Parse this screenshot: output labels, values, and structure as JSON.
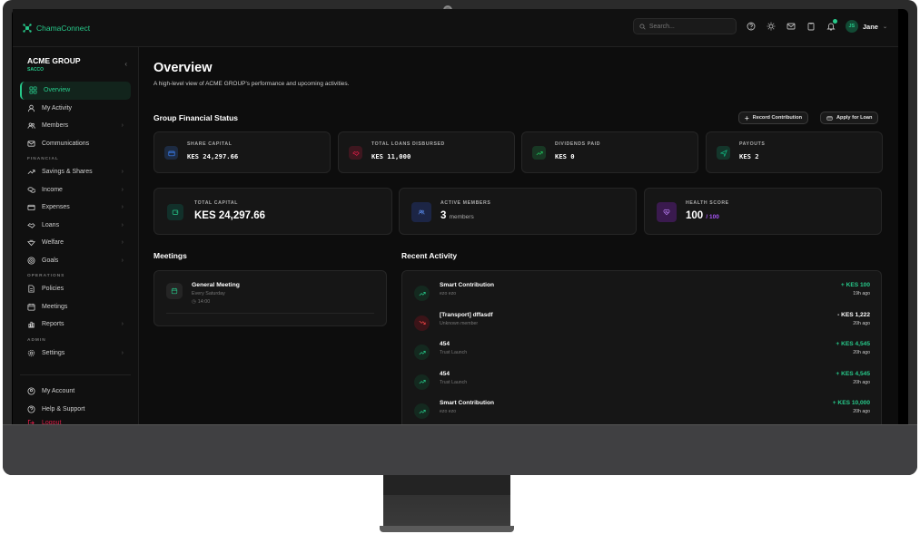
{
  "app": {
    "name": "ChamaConnect"
  },
  "topbar": {
    "search_placeholder": "Search...",
    "user_initials": "JS",
    "user_name": "Jane"
  },
  "sidebar": {
    "org_name": "ACME GROUP",
    "org_type": "SACCO",
    "items_main": [
      {
        "label": "Overview",
        "icon": "grid-icon",
        "active": true
      },
      {
        "label": "My Activity",
        "icon": "user-icon"
      },
      {
        "label": "Members",
        "icon": "users-icon",
        "chevron": true
      },
      {
        "label": "Communications",
        "icon": "mail-icon"
      }
    ],
    "section_financial": "FINANCIAL",
    "items_financial": [
      {
        "label": "Savings & Shares",
        "icon": "trending-up-icon",
        "chevron": true
      },
      {
        "label": "Income",
        "icon": "coins-icon",
        "chevron": true
      },
      {
        "label": "Expenses",
        "icon": "wallet-icon",
        "chevron": true
      },
      {
        "label": "Loans",
        "icon": "handshake-icon",
        "chevron": true
      },
      {
        "label": "Welfare",
        "icon": "heart-hand-icon",
        "chevron": true
      },
      {
        "label": "Goals",
        "icon": "target-icon",
        "chevron": true
      }
    ],
    "section_operations": "OPERATIONS",
    "items_operations": [
      {
        "label": "Policies",
        "icon": "document-icon"
      },
      {
        "label": "Meetings",
        "icon": "calendar-icon"
      },
      {
        "label": "Reports",
        "icon": "bar-chart-icon",
        "chevron": true
      }
    ],
    "section_admin": "ADMIN",
    "items_admin": [
      {
        "label": "Settings",
        "icon": "gear-icon",
        "chevron": true
      }
    ],
    "items_footer": [
      {
        "label": "My Account",
        "icon": "account-icon"
      },
      {
        "label": "Help & Support",
        "icon": "help-icon"
      },
      {
        "label": "Logout",
        "icon": "logout-icon"
      }
    ]
  },
  "overview": {
    "title": "Overview",
    "subtitle": "A high-level view of ACME GROUP's performance and upcoming activities.",
    "financial_status_title": "Group Financial Status",
    "record_contribution_label": "Record Contribution",
    "apply_loan_label": "Apply for Loan",
    "stats": [
      {
        "label": "SHARE CAPITAL",
        "value": "KES 24,297.66",
        "icon": "wallet-icon",
        "color": "#3b82f6"
      },
      {
        "label": "TOTAL LOANS DISBURSED",
        "value": "KES 11,000",
        "icon": "handshake-icon",
        "color": "#e11d48"
      },
      {
        "label": "DIVIDENDS PAID",
        "value": "KES 0",
        "icon": "trending-up-icon",
        "color": "#22c55e"
      },
      {
        "label": "PAYOUTS",
        "value": "KES 2",
        "icon": "send-icon",
        "color": "#10b981"
      }
    ],
    "total_capital": {
      "label": "TOTAL CAPITAL",
      "value": "KES 24,297.66"
    },
    "active_members": {
      "label": "ACTIVE MEMBERS",
      "value": "3",
      "suffix": "members"
    },
    "health_score": {
      "label": "HEALTH SCORE",
      "value": "100",
      "suffix": "/ 100"
    }
  },
  "meetings": {
    "title": "Meetings",
    "items": [
      {
        "name": "General Meeting",
        "schedule": "Every Saturday",
        "time": "14:00"
      }
    ]
  },
  "activity": {
    "title": "Recent Activity",
    "items": [
      {
        "title": "Smart Contribution",
        "sub": "ezo ezo",
        "amount": "+ KES 100",
        "time": "19h ago",
        "direction": "in"
      },
      {
        "title": "[Transport] dffasdf",
        "sub": "Unknown member",
        "amount": "- KES 1,222",
        "time": "20h ago",
        "direction": "out"
      },
      {
        "title": "454",
        "sub": "Trust Launch",
        "amount": "+ KES 4,545",
        "time": "20h ago",
        "direction": "in"
      },
      {
        "title": "454",
        "sub": "Trust Launch",
        "amount": "+ KES 4,545",
        "time": "20h ago",
        "direction": "in"
      },
      {
        "title": "Smart Contribution",
        "sub": "ezo ezo",
        "amount": "+ KES 10,000",
        "time": "20h ago",
        "direction": "in"
      }
    ]
  },
  "colors": {
    "accent": "#27c98a",
    "positive": "#27c98a",
    "negative": "#ffffff",
    "health": "#a855f7"
  }
}
